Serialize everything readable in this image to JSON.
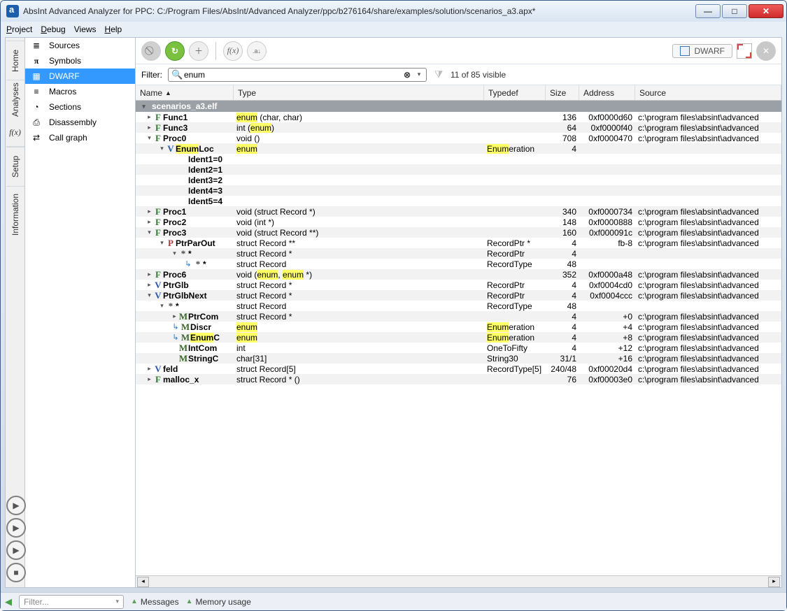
{
  "window": {
    "title": "AbsInt Advanced Analyzer for PPC: C:/Program Files/AbsInt/Advanced Analyzer/ppc/b276164/share/examples/solution/scenarios_a3.apx*"
  },
  "menu": {
    "project": "Project",
    "debug": "Debug",
    "views": "Views",
    "help": "Help"
  },
  "leftrail": {
    "home": "Home",
    "analyses": "Analyses",
    "fx": "f(x)",
    "setup": "Setup",
    "info": "Information"
  },
  "sidebar": {
    "items": [
      {
        "label": "Sources"
      },
      {
        "label": "Symbols"
      },
      {
        "label": "DWARF"
      },
      {
        "label": "Macros"
      },
      {
        "label": "Sections"
      },
      {
        "label": "Disassembly"
      },
      {
        "label": "Call graph"
      }
    ]
  },
  "toolbar": {
    "dwarf": "DWARF"
  },
  "filter": {
    "label": "Filter:",
    "value": "enum",
    "visible": "11 of 85 visible"
  },
  "columns": {
    "name": "Name",
    "type": "Type",
    "typedef": "Typedef",
    "size": "Size",
    "address": "Address",
    "source": "Source"
  },
  "group": "scenarios_a3.elf",
  "src_common": "c:\\program files\\absint\\advanced",
  "rows": [
    {
      "d": 1,
      "e": "r",
      "k": "F",
      "n": "Func1",
      "t_pre": "",
      "t_hl": "enum",
      "t_post": " (char, char)",
      "td": "",
      "sz": "136",
      "ad": "0xf0000d60",
      "sr": true
    },
    {
      "d": 1,
      "e": "r",
      "k": "F",
      "n": "Func3",
      "t_pre": "int (",
      "t_hl": "enum",
      "t_post": ")",
      "td": "",
      "sz": "64",
      "ad": "0xf0000f40",
      "sr": true,
      "alt": true
    },
    {
      "d": 1,
      "e": "d",
      "k": "F",
      "n": "Proc0",
      "t_pre": "void ()",
      "td": "",
      "sz": "708",
      "ad": "0xf0000470",
      "sr": true
    },
    {
      "d": 2,
      "e": "d",
      "k": "V",
      "n_hl": "Enum",
      "n_post": "Loc",
      "t_pre": "",
      "t_hl": "enum",
      "td_hl": "Enum",
      "td_post": "eration",
      "sz": "4",
      "ad": "",
      "sr": false,
      "alt": true
    },
    {
      "d": 3,
      "n": "Ident1=0"
    },
    {
      "d": 3,
      "n": "Ident2=1",
      "alt": true
    },
    {
      "d": 3,
      "n": "Ident3=2"
    },
    {
      "d": 3,
      "n": "Ident4=3",
      "alt": true
    },
    {
      "d": 3,
      "n": "Ident5=4"
    },
    {
      "d": 1,
      "e": "r",
      "k": "F",
      "n": "Proc1",
      "t_pre": "void (struct Record *)",
      "sz": "340",
      "ad": "0xf0000734",
      "sr": true,
      "alt": true
    },
    {
      "d": 1,
      "e": "r",
      "k": "F",
      "n": "Proc2",
      "t_pre": "void (int *)",
      "sz": "148",
      "ad": "0xf0000888",
      "sr": true
    },
    {
      "d": 1,
      "e": "d",
      "k": "F",
      "n": "Proc3",
      "t_pre": "void (struct Record **)",
      "sz": "160",
      "ad": "0xf000091c",
      "sr": true,
      "alt": true
    },
    {
      "d": 2,
      "e": "d",
      "k": "P",
      "n": "PtrParOut",
      "t_pre": "struct Record **",
      "td": "RecordPtr *",
      "sz": "4",
      "ad": "fb-8",
      "sr": true
    },
    {
      "d": 3,
      "e": "d",
      "k": "S",
      "n": "*",
      "t_pre": "struct Record *",
      "td": "RecordPtr",
      "sz": "4",
      "alt": true
    },
    {
      "d": 4,
      "arrow": true,
      "k": "S",
      "n": "*",
      "t_pre": "struct Record",
      "td": "RecordType",
      "sz": "48"
    },
    {
      "d": 1,
      "e": "r",
      "k": "F",
      "n": "Proc6",
      "t_pre": "void (",
      "t_hl": "enum",
      "t_mid": ", ",
      "t_hl2": "enum",
      "t_post": " *)",
      "sz": "352",
      "ad": "0xf0000a48",
      "sr": true,
      "alt": true
    },
    {
      "d": 1,
      "e": "r",
      "k": "V",
      "n": "PtrGlb",
      "t_pre": "struct Record *",
      "td": "RecordPtr",
      "sz": "4",
      "ad": "0xf0004cd0",
      "sr": true
    },
    {
      "d": 1,
      "e": "d",
      "k": "V",
      "n": "PtrGlbNext",
      "t_pre": "struct Record *",
      "td": "RecordPtr",
      "sz": "4",
      "ad": "0xf0004ccc",
      "sr": true,
      "alt": true
    },
    {
      "d": 2,
      "e": "d",
      "k": "S",
      "n": "*",
      "t_pre": "struct Record",
      "td": "RecordType",
      "sz": "48"
    },
    {
      "d": 3,
      "e": "r",
      "k": "M",
      "n": "PtrCom",
      "t_pre": "struct Record *",
      "sz": "4",
      "ad": "+0",
      "sr": true,
      "alt": true
    },
    {
      "d": 3,
      "arrow": true,
      "k": "M",
      "n": "Discr",
      "t_pre": "",
      "t_hl": "enum",
      "td_hl": "Enum",
      "td_post": "eration",
      "sz": "4",
      "ad": "+4",
      "sr": true
    },
    {
      "d": 3,
      "arrow": true,
      "k": "M",
      "n_hl": "Enum",
      "n_post": "C",
      "t_pre": "",
      "t_hl": "enum",
      "td_hl": "Enum",
      "td_post": "eration",
      "sz": "4",
      "ad": "+8",
      "sr": true,
      "alt": true
    },
    {
      "d": 3,
      "k": "M",
      "n": "IntCom",
      "t_pre": "int",
      "td": "OneToFifty",
      "sz": "4",
      "ad": "+12",
      "sr": true
    },
    {
      "d": 3,
      "k": "M",
      "n": "StringC",
      "t_pre": "char[31]",
      "td": "String30",
      "sz": "31/1",
      "ad": "+16",
      "sr": true,
      "alt": true
    },
    {
      "d": 1,
      "e": "r",
      "k": "V",
      "n": "feld",
      "t_pre": "struct Record[5]",
      "td": "RecordType[5]",
      "sz": "240/48",
      "ad": "0xf00020d4",
      "sr": true
    },
    {
      "d": 1,
      "e": "r",
      "k": "F",
      "n": "malloc_x",
      "t_pre": "struct Record * ()",
      "sz": "76",
      "ad": "0xf00003e0",
      "sr": true,
      "alt": true
    }
  ],
  "status": {
    "filter_ph": "Filter...",
    "messages": "Messages",
    "memory": "Memory usage"
  }
}
